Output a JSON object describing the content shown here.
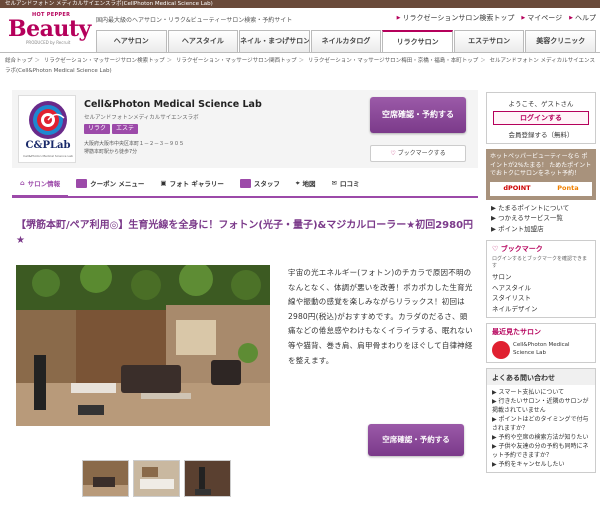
{
  "topbar": "セルアンドフォトン メディカルサイエンスラボ(CellPhoton Medical Science Lab)",
  "logo": {
    "hotpepper": "HOT PEPPER",
    "beauty": "Beauty",
    "produced": "PRODUCED by Recruit"
  },
  "tagline": "国内最大級のヘアサロン・リラク&ビューティーサロン検索・予約サイト",
  "toplinks": [
    "リラクゼーションサロン検索トップ",
    "マイページ",
    "ヘルプ"
  ],
  "nav": [
    "ヘアサロン",
    "ヘアスタイル",
    "ネイル・まつげサロン",
    "ネイルカタログ",
    "リラクサロン",
    "エステサロン",
    "美容クリニック"
  ],
  "breadcrumb": [
    "総合トップ",
    "リラクゼーション・マッサージサロン検索トップ",
    "リラクゼーション・マッサージサロン関西トップ",
    "リラクゼーション・マッサージサロン梅田・京橋・福島・本町トップ",
    "セルアンドフォトン メディカルサイエンスラボ(Cell&Photon Medical Science Lab)"
  ],
  "salon": {
    "name": "Cell&Photon Medical Science Lab",
    "kana": "セルアンドフォトンメディカルサイエンスラボ",
    "tags": [
      "リラク",
      "エステ"
    ],
    "address": "大阪府大阪市中央区本町１－２－３－９０５",
    "access": "堺筋本町駅から徒歩7分",
    "logo_text": "C&PLab",
    "logo_sub": "Cell&Photon Medical Science Lab"
  },
  "reserve_label": "空席確認・予約する",
  "bookmark_label": "ブックマークする",
  "tabs": [
    "サロン情報",
    "クーポン メニュー",
    "フォト ギャラリー",
    "スタッフ",
    "地図",
    "口コミ"
  ],
  "headline": "【堺筋本町/ペア利用◎】生育光線を全身に！フォトン(光子・量子)&マジカルローラー★初回2980円★",
  "description": "宇宙の光エネルギー(フォトン)のチカラで原因不明のなんとなく、体調が悪いを改善！ポカポカした生育光線や振動の感覚を楽しみながらリラックス！初回は2980円(税込)がおすすめです。カラダのだるさ、頭痛などの倦怠感やわけもなくイライラする、眠れない等や猫背、巻き肩、肩甲骨まわりをほぐして自律神経を整えます。",
  "sidebar": {
    "welcome": "ようこそ、ゲストさん",
    "login": "ログインする",
    "register": "会員登録する（無料）",
    "point_text": "ホットペッパービューティーなら ポイントが2%たまる！ ためたポイントでおトクにサロンをネット予約！",
    "point_logos": [
      "dPOINT",
      "Ponta"
    ],
    "links": [
      "たまるポイントについて",
      "つかえるサービス一覧",
      "ポイント加盟店"
    ],
    "bookmark_title": "ブックマーク",
    "bookmark_note": "ログインするとブックマークを確認できます",
    "bookmark_links": [
      "サロン",
      "ヘアスタイル",
      "スタイリスト",
      "ネイルデザイン"
    ],
    "recent_title": "最近見たサロン",
    "recent_salon": "Cell&Photon Medical Science Lab",
    "faq_title": "よくある問い合わせ",
    "faq": [
      "スマート支払いについて",
      "行きたいサロン・近隣のサロンが掲載されていません",
      "ポイントはどのタイミングで付与されますか？",
      "予約や空席の検索方法が知りたい",
      "子供や友達の分の予約も同時にネット予約できますか？",
      "予約をキャンセルしたい"
    ]
  }
}
